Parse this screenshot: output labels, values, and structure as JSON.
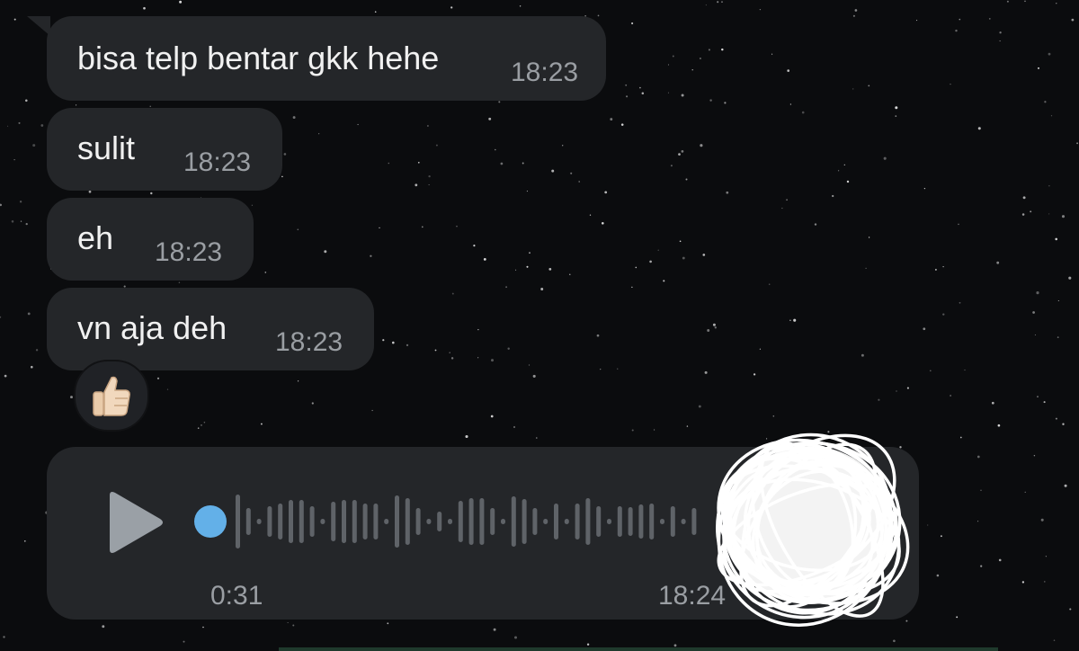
{
  "messages": [
    {
      "text": "bisa telp bentar gkk hehe",
      "time": "18:23"
    },
    {
      "text": "sulit",
      "time": "18:23"
    },
    {
      "text": "eh",
      "time": "18:23"
    },
    {
      "text": "vn aja deh",
      "time": "18:23"
    }
  ],
  "reaction": {
    "emoji": "👍🏻",
    "icon": "thumbs-up-icon"
  },
  "voice_message": {
    "duration": "0:31",
    "time": "18:24",
    "played_fraction": 0,
    "icon": "play-icon"
  },
  "colors": {
    "background": "#0b0c0e",
    "bubble": "#242629",
    "accent": "#63b0e8",
    "waveform": "#5f6368",
    "meta_text": "#9a9ea3"
  }
}
